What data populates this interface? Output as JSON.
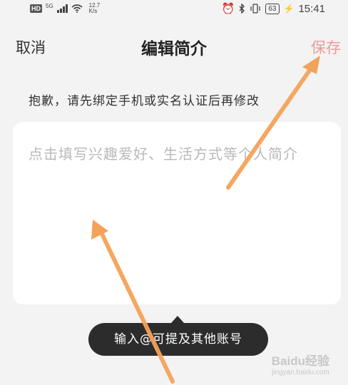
{
  "status_bar": {
    "network_badge": "HD",
    "signal_label": "5G",
    "speed_value": "12.7",
    "speed_unit": "K/s",
    "battery": "63",
    "time": "15:41",
    "icons": [
      "alarm-icon",
      "bluetooth-icon",
      "vibrate-icon",
      "charging-icon",
      "wifi-icon",
      "signal-icon"
    ]
  },
  "header": {
    "cancel_label": "取消",
    "title": "编辑简介",
    "save_label": "保存",
    "save_color": "#e99a9a"
  },
  "notice": "抱歉，请先绑定手机或实名认证后再修改",
  "bio_input": {
    "placeholder": "点击填写兴趣爱好、生活方式等个人简介"
  },
  "tooltip": "输入@可提及其他账号",
  "annotation": {
    "arrow_color": "#f3a25a"
  },
  "watermark": {
    "brand": "Baidu经验",
    "sub": "jingyan.baidu.com"
  }
}
